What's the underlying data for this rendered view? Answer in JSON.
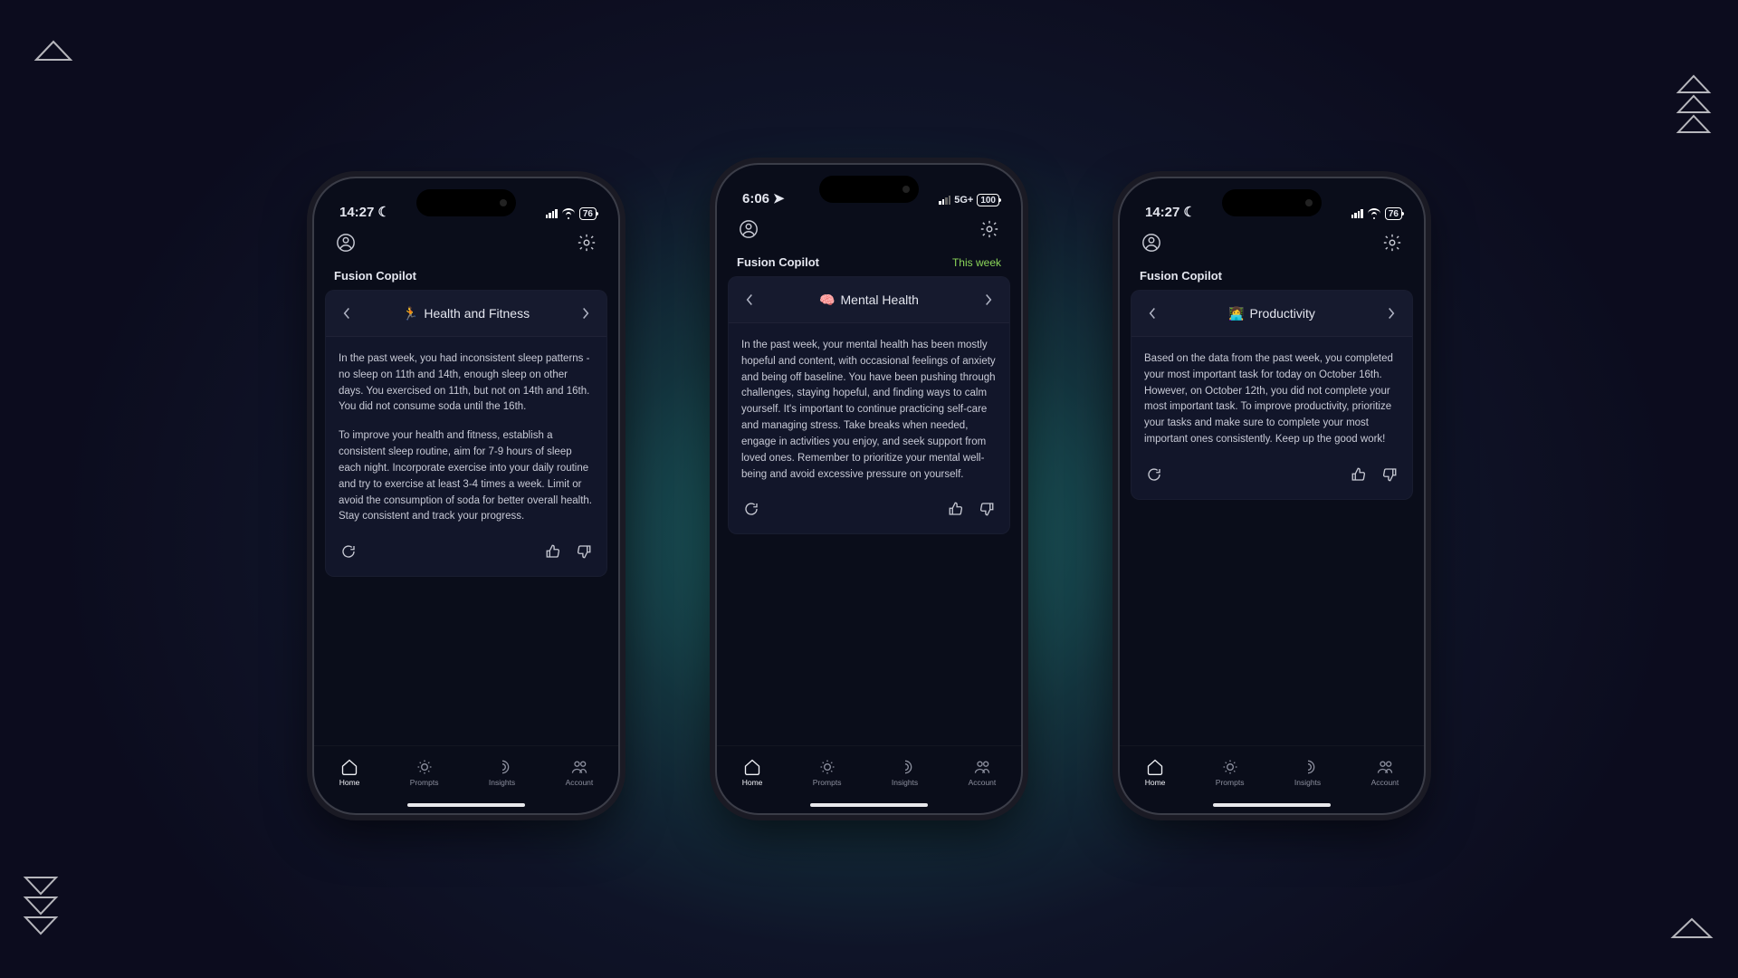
{
  "phones": [
    {
      "status": {
        "time": "14:27",
        "timeIcon": "moon",
        "net": "",
        "battery": "76"
      },
      "app_title": "Fusion Copilot",
      "week_label": "",
      "card": {
        "emoji": "🏃",
        "title": "Health and Fitness",
        "p1": "In the past week, you had inconsistent sleep patterns - no sleep on 11th and 14th, enough sleep on other days. You exercised on 11th, but not on 14th and 16th. You did not consume soda until the 16th.",
        "p2": "To improve your health and fitness, establish a consistent sleep routine, aim for 7-9 hours of sleep each night. Incorporate exercise into your daily routine and try to exercise at least 3-4 times a week. Limit or avoid the consumption of soda for better overall health. Stay consistent and track your progress."
      }
    },
    {
      "status": {
        "time": "6:06",
        "timeIcon": "location",
        "net": "5G+",
        "battery": "100"
      },
      "app_title": "Fusion Copilot",
      "week_label": "This week",
      "card": {
        "emoji": "🧠",
        "title": "Mental Health",
        "p1": "In the past week, your mental health has been mostly hopeful and content, with occasional feelings of anxiety and being off baseline. You have been pushing through challenges, staying hopeful, and finding ways to calm yourself. It's important to continue practicing self-care and managing stress. Take breaks when needed, engage in activities you enjoy, and seek support from loved ones. Remember to prioritize your mental well-being and avoid excessive pressure on yourself.",
        "p2": ""
      }
    },
    {
      "status": {
        "time": "14:27",
        "timeIcon": "moon",
        "net": "",
        "battery": "76"
      },
      "app_title": "Fusion Copilot",
      "week_label": "",
      "card": {
        "emoji": "👩‍💻",
        "title": "Productivity",
        "p1": "Based on the data from the past week, you completed your most important task for today on October 16th. However, on October 12th, you did not complete your most important task. To improve productivity, prioritize your tasks and make sure to complete your most important ones consistently. Keep up the good work!",
        "p2": ""
      }
    }
  ],
  "nav": {
    "home": "Home",
    "prompts": "Prompts",
    "insights": "Insights",
    "account": "Account"
  }
}
